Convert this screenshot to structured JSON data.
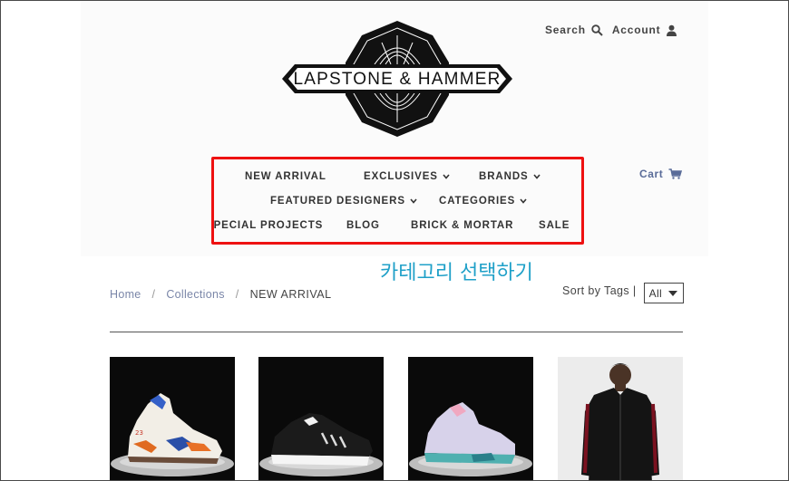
{
  "header": {
    "search_label": "Search",
    "account_label": "Account",
    "logo_text": "LAPSTONE & HAMMER",
    "cart_label": "Cart"
  },
  "nav": {
    "items": [
      {
        "label": "NEW ARRIVAL",
        "dropdown": false
      },
      {
        "label": "EXCLUSIVES",
        "dropdown": true
      },
      {
        "label": "BRANDS",
        "dropdown": true
      },
      {
        "label": "FEATURED DESIGNERS",
        "dropdown": true
      },
      {
        "label": "CATEGORIES",
        "dropdown": true
      },
      {
        "label": "SPECIAL PROJECTS",
        "dropdown": false
      },
      {
        "label": "BLOG",
        "dropdown": false
      },
      {
        "label": "BRICK & MORTAR",
        "dropdown": false
      },
      {
        "label": "SALE",
        "dropdown": false
      }
    ]
  },
  "annotation": {
    "text": "카테고리 선택하기",
    "color": "#1fa0c8",
    "highlight_color": "#ee1111"
  },
  "breadcrumb": {
    "home": "Home",
    "separator": "/",
    "collections": "Collections",
    "current": "NEW ARRIVAL"
  },
  "sort": {
    "label": "Sort by Tags |",
    "selected": "All"
  },
  "products": [
    {
      "name": "sneaker-white-orange-blue-icon"
    },
    {
      "name": "sneaker-black-white-icon"
    },
    {
      "name": "sneaker-lavender-teal-icon"
    },
    {
      "name": "track-jacket-black-red-icon"
    }
  ]
}
